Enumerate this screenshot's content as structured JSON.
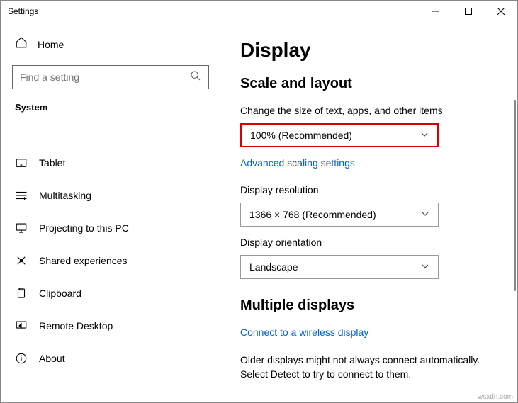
{
  "window": {
    "title": "Settings"
  },
  "sidebar": {
    "home": "Home",
    "search_placeholder": "Find a setting",
    "system": "System",
    "items": [
      {
        "label": "Tablet"
      },
      {
        "label": "Multitasking"
      },
      {
        "label": "Projecting to this PC"
      },
      {
        "label": "Shared experiences"
      },
      {
        "label": "Clipboard"
      },
      {
        "label": "Remote Desktop"
      },
      {
        "label": "About"
      }
    ]
  },
  "main": {
    "title": "Display",
    "scale_section": "Scale and layout",
    "scale_label": "Change the size of text, apps, and other items",
    "scale_value": "100% (Recommended)",
    "advanced_link": "Advanced scaling settings",
    "resolution_label": "Display resolution",
    "resolution_value": "1366 × 768 (Recommended)",
    "orientation_label": "Display orientation",
    "orientation_value": "Landscape",
    "multiple_section": "Multiple displays",
    "wireless_link": "Connect to a wireless display",
    "older_text": "Older displays might not always connect automatically. Select Detect to try to connect to them."
  },
  "watermark": "wsxdn.com"
}
